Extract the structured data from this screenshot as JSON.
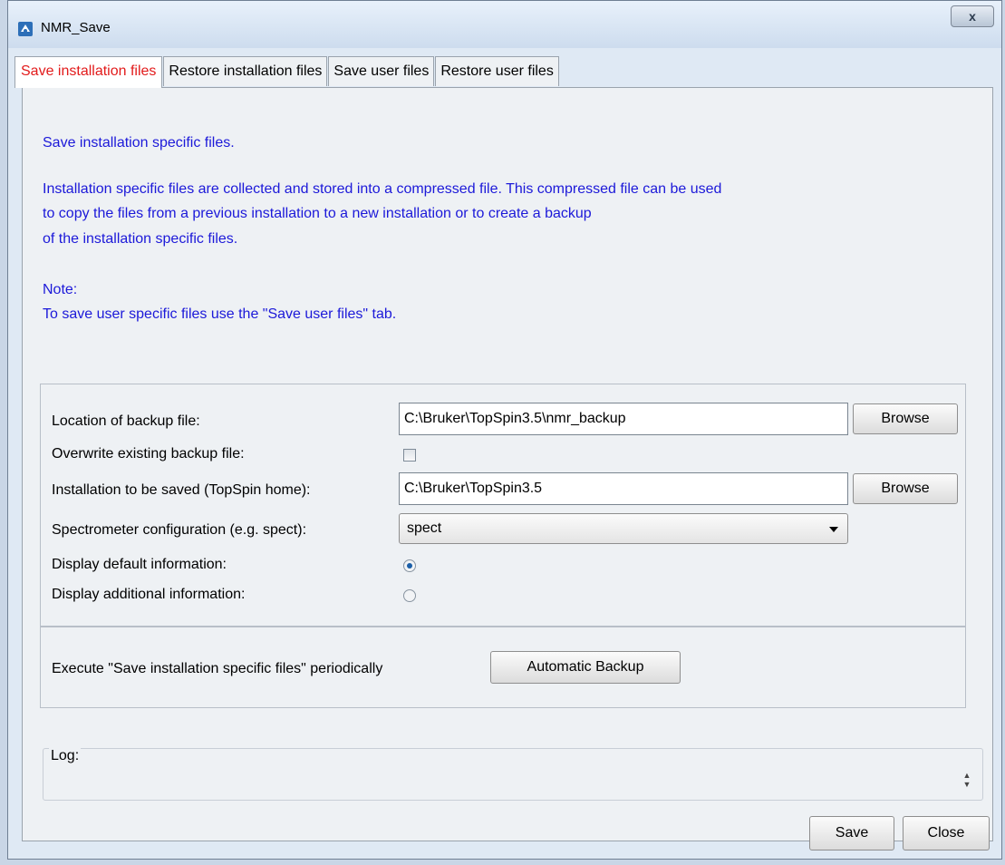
{
  "window": {
    "title": "NMR_Save",
    "close_glyph": "x"
  },
  "tabs": [
    {
      "label": "Save installation files",
      "active": true
    },
    {
      "label": "Restore installation files",
      "active": false
    },
    {
      "label": "Save user files",
      "active": false
    },
    {
      "label": "Restore user files",
      "active": false
    }
  ],
  "info": {
    "line1": "Save installation specific files.",
    "line2": "Installation specific files are collected and stored into a compressed file. This compressed file can be used",
    "line3": "to copy the files from a previous installation to a new installation or to create a backup",
    "line4": "of the installation specific files.",
    "note_label": "Note:",
    "note_text": "To save user specific files use the \"Save user files\" tab."
  },
  "form": {
    "location_label": "Location of backup file:",
    "location_value": "C:\\Bruker\\TopSpin3.5\\nmr_backup",
    "browse_label": "Browse",
    "overwrite_label": "Overwrite existing backup file:",
    "overwrite_checked": false,
    "installation_label": "Installation to be saved (TopSpin home):",
    "installation_value": "C:\\Bruker\\TopSpin3.5",
    "browse2_label": "Browse",
    "spectrometer_label": "Spectrometer configuration (e.g. spect):",
    "spectrometer_value": "spect",
    "display_default_label": "Display default information:",
    "display_additional_label": "Display additional information:",
    "display_mode": "default"
  },
  "periodic": {
    "label": "Execute \"Save installation specific files\" periodically",
    "button": "Automatic Backup"
  },
  "log": {
    "label": "Log:"
  },
  "footer": {
    "save_label": "Save",
    "close_label": "Close"
  },
  "colors": {
    "info_text": "#1c19d9",
    "active_tab_text": "#e21b1b",
    "radio_selected": "#1b5fa8"
  }
}
